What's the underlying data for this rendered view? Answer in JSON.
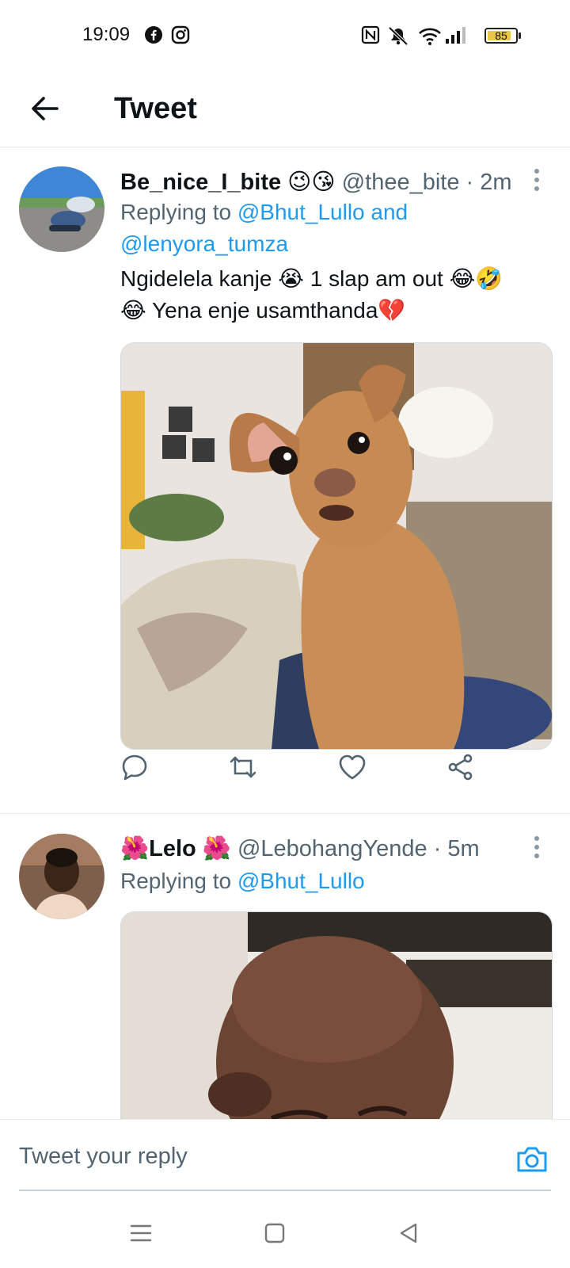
{
  "status_bar": {
    "time": "19:09",
    "battery": "85",
    "battery_level": 0.85,
    "icons": [
      "facebook-icon",
      "instagram-icon",
      "nfc-icon",
      "mute-icon",
      "wifi-icon",
      "signal-icon",
      "battery-icon"
    ]
  },
  "header": {
    "title": "Tweet"
  },
  "tweets": [
    {
      "display_name": "Be_nice_I_bite",
      "name_emojis": "😉😘",
      "handle": "@thee_bite",
      "time": "· 2m",
      "replying_prefix": "Replying to",
      "replying_to": "@Bhut_Lullo and",
      "replying_to_2": "@lenyora_tumza",
      "text_line_1": "Ngidelela kanje 😭 1 slap am out 😂🤣",
      "text_line_2": "😂 Yena enje usamthanda💔",
      "media": "photo of a small brown chihuahua sitting on a sofa"
    },
    {
      "name_prefix_emoji": "🌺",
      "display_name": "Lelo",
      "name_suffix_emoji": "🌺",
      "handle": "@LebohangYende",
      "time": "· 5m",
      "replying_prefix": "Replying to",
      "replying_to": "@Bhut_Lullo",
      "media": "photo of a man's head with eyes squeezed shut"
    }
  ],
  "reply_bar": {
    "placeholder": "Tweet your reply"
  },
  "colors": {
    "link": "#1d9bf0",
    "secondary_text": "#536471",
    "primary_text": "#0f1419",
    "divider": "#e6ecf0"
  }
}
